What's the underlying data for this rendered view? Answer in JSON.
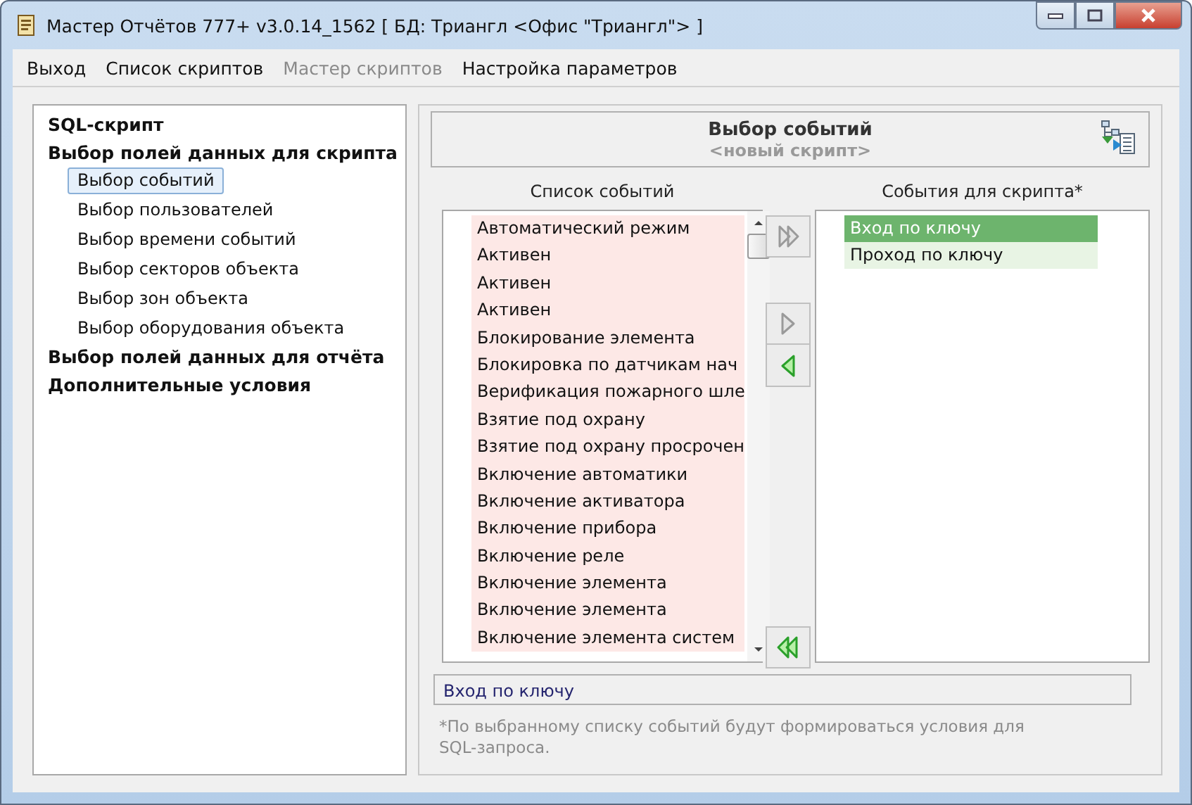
{
  "window": {
    "title": "Мастер Отчётов 777+ v3.0.14_1562 [ БД: Триангл <Офис \"Триангл\"> ]"
  },
  "menu": [
    {
      "label": "Выход",
      "disabled": false
    },
    {
      "label": "Список скриптов",
      "disabled": false
    },
    {
      "label": "Мастер скриптов",
      "disabled": true
    },
    {
      "label": "Настройка параметров",
      "disabled": false
    }
  ],
  "sidebar": {
    "items": [
      {
        "label": "SQL-скрипт",
        "selected": false
      },
      {
        "label": "Выбор полей данных для скрипта",
        "selected": false,
        "children": [
          {
            "label": "Выбор событий",
            "selected": true
          },
          {
            "label": "Выбор пользователей",
            "selected": false
          },
          {
            "label": "Выбор времени событий",
            "selected": false
          },
          {
            "label": "Выбор секторов объекта",
            "selected": false
          },
          {
            "label": "Выбор зон объекта",
            "selected": false
          },
          {
            "label": "Выбор оборудования объекта",
            "selected": false
          }
        ]
      },
      {
        "label": "Выбор полей данных для отчёта",
        "selected": false
      },
      {
        "label": "Дополнительные условия",
        "selected": false
      }
    ]
  },
  "header": {
    "title": "Выбор событий",
    "subtitle": "<новый скрипт>"
  },
  "events_list": {
    "title": "Список событий",
    "rows": [
      {
        "label": "Автоматический режим",
        "selected": false
      },
      {
        "label": "Активен",
        "selected": false
      },
      {
        "label": "Активен",
        "selected": false
      },
      {
        "label": "Активен",
        "selected": false
      },
      {
        "label": "Блокирование элемента",
        "selected": false
      },
      {
        "label": "Блокировка по датчикам нач",
        "selected": false
      },
      {
        "label": "Верификация пожарного шле",
        "selected": false
      },
      {
        "label": "Взятие под охрану",
        "selected": false
      },
      {
        "label": "Взятие под охрану просрочен",
        "selected": false
      },
      {
        "label": "Включение автоматики",
        "selected": false
      },
      {
        "label": "Включение активатора",
        "selected": false
      },
      {
        "label": "Включение прибора",
        "selected": false
      },
      {
        "label": "Включение реле",
        "selected": false
      },
      {
        "label": "Включение элемента",
        "selected": false
      },
      {
        "label": "Включение элемента",
        "selected": false
      },
      {
        "label": "Включение элемента систем",
        "selected": false
      }
    ]
  },
  "transfer_buttons": [
    {
      "kind": "add_all",
      "disabled": true
    },
    {
      "kind": "add",
      "disabled": true
    },
    {
      "kind": "remove",
      "disabled": false
    },
    {
      "kind": "remove_all",
      "disabled": false
    }
  ],
  "script_events": {
    "title": "События для скрипта*",
    "rows": [
      {
        "label": "Вход по ключу",
        "selected": true
      },
      {
        "label": "Проход по ключу",
        "selected": false
      }
    ]
  },
  "status_field": {
    "value": "Вход по ключу"
  },
  "note": "*По выбранному списку событий будут формироваться условия для SQL-запроса."
}
